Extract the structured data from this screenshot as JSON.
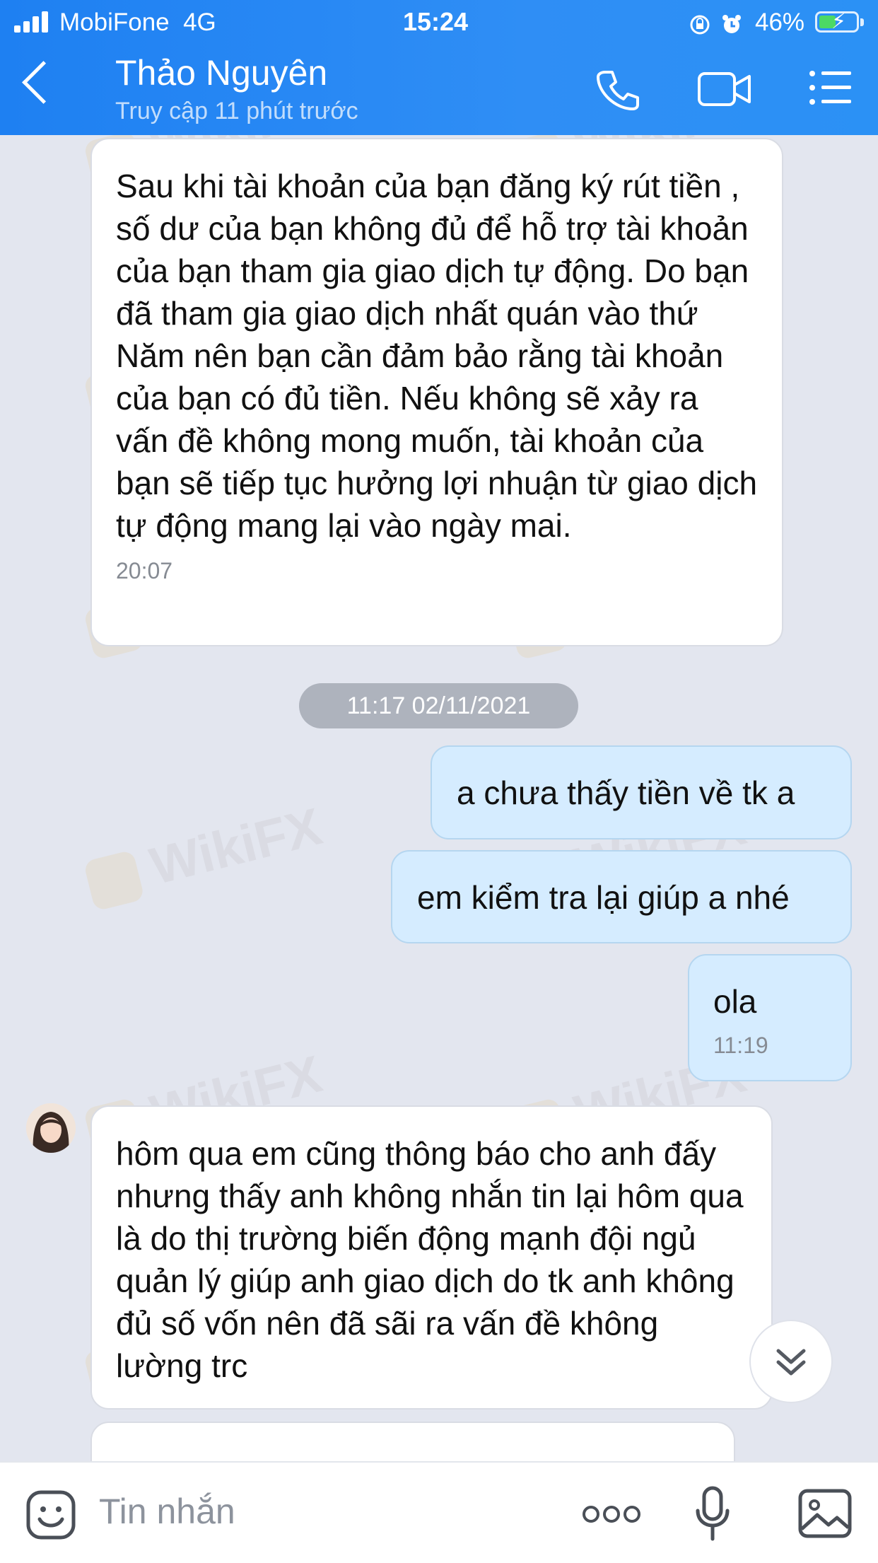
{
  "status_bar": {
    "carrier": "MobiFone",
    "network": "4G",
    "time": "15:24",
    "battery": "46%",
    "battery_level": 0.46
  },
  "header": {
    "contact_name": "Thảo Nguyên",
    "contact_status": "Truy cập 11 phút trước",
    "icons": [
      "back-icon",
      "phone-icon",
      "video-icon",
      "menu-icon"
    ]
  },
  "watermark": "WikiFX",
  "messages": [
    {
      "side": "received",
      "text": "Sau khi tài khoản của bạn đăng ký rút tiền , số dư của bạn không đủ để hỗ trợ tài khoản của bạn tham gia giao dịch tự động.  Do bạn đã tham gia giao dịch nhất quán vào thứ Năm nên bạn cần đảm bảo rằng tài khoản của bạn có đủ tiền. Nếu không sẽ xảy ra vấn đề không mong muốn, tài khoản của bạn sẽ tiếp tục hưởng lợi nhuận từ giao dịch tự động mang lại vào ngày mai.",
      "time": "20:07"
    },
    {
      "side": "date",
      "text": "11:17 02/11/2021"
    },
    {
      "side": "sent",
      "text": "a chưa thấy tiền về tk a"
    },
    {
      "side": "sent",
      "text": "em kiểm tra lại giúp a nhé"
    },
    {
      "side": "sent",
      "text": "ola",
      "time": "11:19"
    },
    {
      "side": "received",
      "text": "hôm qua em cũng thông báo cho anh đấy nhưng thấy anh không nhắn tin lại hôm qua là do thị trường biến động mạnh đội ngủ quản lý giúp anh giao dịch do tk anh không đủ số vốn nên đã sãi ra vấn đề không lường trc"
    },
    {
      "side": "received",
      "text": ""
    }
  ],
  "input": {
    "placeholder": "Tin nhắn"
  },
  "bottom_icons": [
    "sticker-icon",
    "more-icon",
    "microphone-icon",
    "image-icon"
  ],
  "colors": {
    "header": "#2b8af4",
    "sent_bubble": "#d5ecff",
    "received_bubble": "#ffffff",
    "background": "#e3e6ef"
  }
}
